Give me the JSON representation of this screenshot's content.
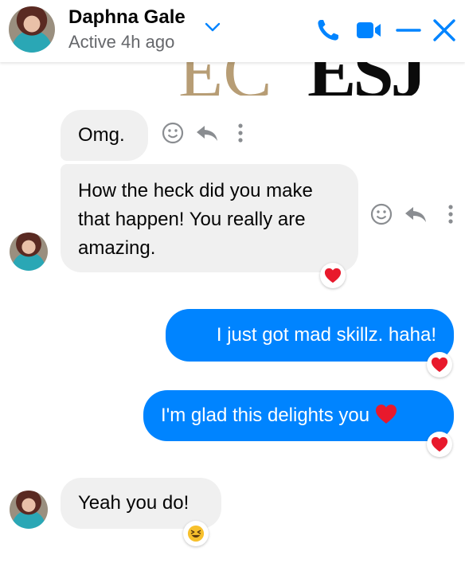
{
  "header": {
    "name": "Daphna Gale",
    "status": "Active 4h ago",
    "icons": [
      "chevron-down-icon",
      "phone-icon",
      "video-camera-icon",
      "minimize-icon",
      "close-icon"
    ],
    "accent_color": "#0084ff"
  },
  "shared_image": {
    "left_letters": "EC",
    "right_letters": "ESJ"
  },
  "messages": [
    {
      "direction": "incoming",
      "text": "Omg."
    },
    {
      "direction": "incoming",
      "text": "How the heck did you make that happen! You really are amazing.",
      "reaction": "heart"
    },
    {
      "direction": "outgoing",
      "text": "I just got mad skillz. haha!",
      "reaction": "heart"
    },
    {
      "direction": "outgoing",
      "text": "I'm glad this delights you",
      "inline_emoji": "heart",
      "reaction": "heart"
    },
    {
      "direction": "incoming",
      "text": "Yeah you do!",
      "reaction": "laughing-face"
    }
  ],
  "message_actions": [
    "smiley-icon",
    "reply-icon",
    "more-icon"
  ]
}
